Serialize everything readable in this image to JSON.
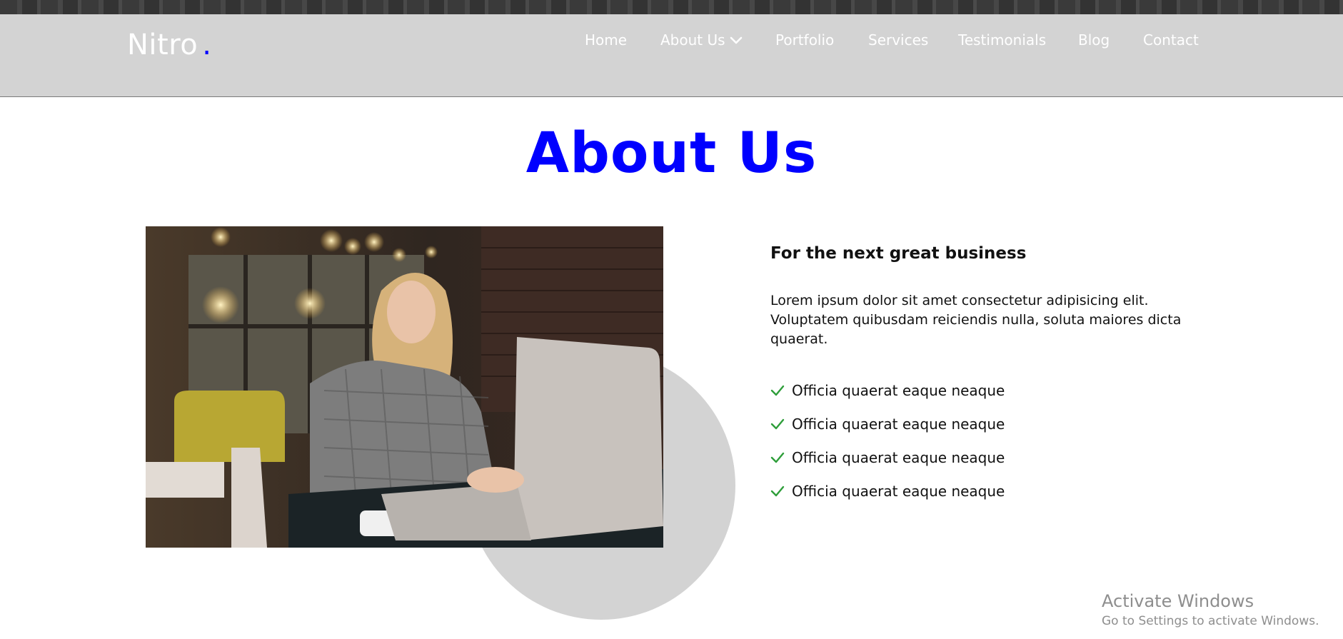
{
  "header": {
    "brand": "Nitro",
    "brand_dot": ".",
    "nav": [
      {
        "label": "Home"
      },
      {
        "label": "About Us",
        "has_dropdown": true
      },
      {
        "label": "Portfolio"
      },
      {
        "label": "Services"
      },
      {
        "label": "Testimonials"
      },
      {
        "label": "Blog"
      },
      {
        "label": "Contact"
      }
    ]
  },
  "about": {
    "title": "About Us",
    "subheading": "For the next great business",
    "paragraph": "Lorem ipsum dolor sit amet consectetur adipisicing elit. Voluptatem quibusdam reiciendis nulla, soluta maiores dicta quaerat.",
    "features": [
      "Officia quaerat eaque neaque",
      "Officia quaerat eaque neaque",
      "Officia quaerat eaque neaque",
      "Officia quaerat eaque neaque"
    ]
  },
  "watermark": {
    "title": "Activate Windows",
    "subtitle": "Go to Settings to activate Windows."
  },
  "colors": {
    "accent": "#0000ff",
    "header_bg": "#d3d3d3",
    "check": "#2e9e3a"
  },
  "icons": {
    "dropdown": "chevron-down-icon",
    "feature": "check-icon"
  }
}
